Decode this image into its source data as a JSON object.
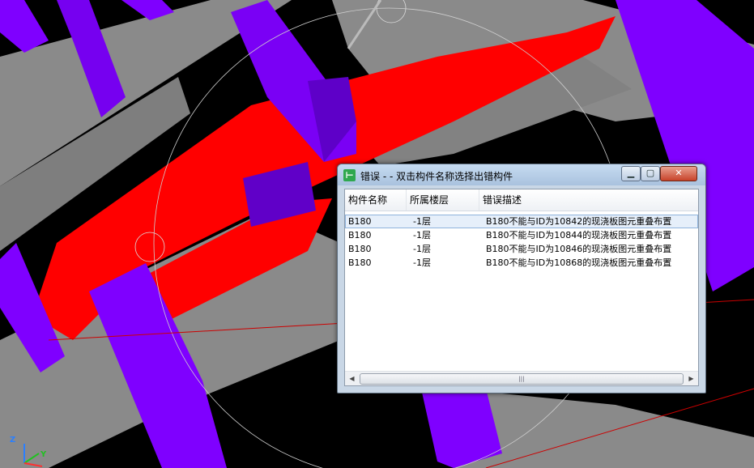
{
  "dialog": {
    "title": "错误 - - 双击构件名称选择出错构件",
    "app_icon_glyph": "⊢",
    "minimize_glyph": "▁",
    "maximize_glyph": "▢",
    "close_glyph": "✕",
    "columns": [
      "构件名称",
      "所属楼层",
      "错误描述"
    ],
    "rows": [
      {
        "name": "B180",
        "floor": "-1层",
        "desc": "B180不能与ID为10842的现浇板图元重叠布置"
      },
      {
        "name": "B180",
        "floor": "-1层",
        "desc": "B180不能与ID为10844的现浇板图元重叠布置"
      },
      {
        "name": "B180",
        "floor": "-1层",
        "desc": "B180不能与ID为10846的现浇板图元重叠布置"
      },
      {
        "name": "B180",
        "floor": "-1层",
        "desc": "B180不能与ID为10868的现浇板图元重叠布置"
      }
    ],
    "scroll_left_glyph": "◀",
    "scroll_right_glyph": "▶",
    "scroll_thumb_glyph": "|||"
  },
  "axes": {
    "z": "Z",
    "y": "Y"
  },
  "colors": {
    "beam": "#8a8a8a",
    "column": "#8000ff",
    "error_slab": "#ff0000",
    "background": "#000000"
  }
}
